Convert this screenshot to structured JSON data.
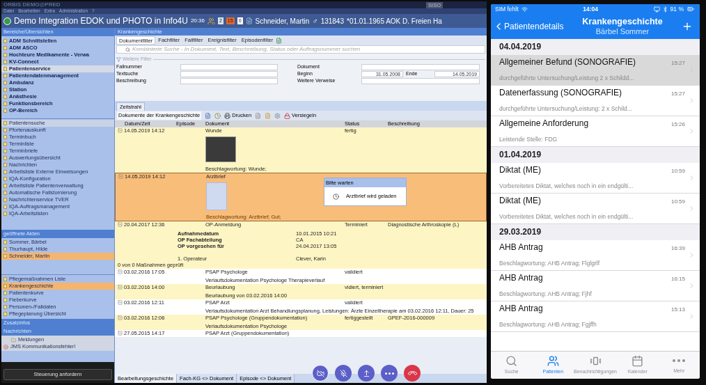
{
  "app": {
    "title": "ORBIS DEMO@PRED",
    "menu": [
      "Datei",
      "Bearbeiten",
      "Extra",
      "Administration",
      "?"
    ],
    "meeting_title": "Demo Integration EDOK und PHOTO in Info4U",
    "time": "20:36",
    "badges": [
      {
        "text": "2",
        "color": "#d6e2f3"
      },
      {
        "text": "15",
        "color": "#e0662e"
      },
      {
        "text": "0",
        "color": "#ffffff"
      }
    ],
    "patient": {
      "name": "Schneider, Martin",
      "gender": "♂",
      "id": "131843",
      "details": "*01.01.1965 AOK D. Freien Ha"
    },
    "top_right": "SISO"
  },
  "sidebar": {
    "header": "Bereiche/Übersichten",
    "areas": [
      {
        "label": "ADM Schnittstellen",
        "selected": false
      },
      {
        "label": "ADM ASCO",
        "selected": false
      },
      {
        "label": "Hochteure Medikamente - Verwa",
        "selected": false
      },
      {
        "label": "KV-Connect",
        "selected": false
      },
      {
        "label": "Patientenservice",
        "selected": true
      },
      {
        "label": "Patientendatenmanagement",
        "selected": false
      },
      {
        "label": "Ambulanz",
        "selected": false
      },
      {
        "label": "Station",
        "selected": false
      },
      {
        "label": "Anästhesie",
        "selected": false
      },
      {
        "label": "Funktionsbereich",
        "selected": false
      },
      {
        "label": "OP-Bereich",
        "selected": false
      }
    ],
    "tools": [
      {
        "label": "Patientensuche",
        "selected": true
      },
      {
        "label": "Pfortenauskunft",
        "selected": false
      },
      {
        "label": "Terminbuch",
        "selected": false
      },
      {
        "label": "Terminliste",
        "selected": false
      },
      {
        "label": "Terminbriefe",
        "selected": false
      },
      {
        "label": "Auswertungsübersicht",
        "selected": false
      },
      {
        "label": "Nachrichten",
        "selected": false
      },
      {
        "label": "Arbeitsliste Externe Einweisungen",
        "selected": false
      },
      {
        "label": "IQA-Konfiguration",
        "selected": false
      },
      {
        "label": "Arbeitsliste Patientenverwaltung",
        "selected": false
      },
      {
        "label": "Automatische Fallstornierung",
        "selected": false
      },
      {
        "label": "Nachrichtenservice TVER",
        "selected": false
      },
      {
        "label": "IQA-Auftragsmanagement",
        "selected": false
      },
      {
        "label": "IQA-Arbeitslisten",
        "selected": false
      }
    ],
    "open_header": "geöffnete Akten",
    "open_files": [
      {
        "label": "Sommer, Bärbel",
        "selected": false
      },
      {
        "label": "Thurhaupt, Hilde",
        "selected": false
      },
      {
        "label": "Schneider, Martin",
        "selected": true
      }
    ],
    "views": [
      {
        "label": "Pflegemaßnahmen Liste",
        "selected": false
      },
      {
        "label": "Krankengeschichte",
        "selected": true
      },
      {
        "label": "Patientenkurve",
        "selected": false
      },
      {
        "label": "Fieberkurve",
        "selected": false
      },
      {
        "label": "Personen-/Falldaten",
        "selected": false
      },
      {
        "label": "Pflegeplanung Übersicht",
        "selected": false
      }
    ],
    "extra_header": "Zusatzinfos",
    "messages_header": "Nachrichten",
    "messages": [
      {
        "label": "Meldungen",
        "kind": "folder"
      },
      {
        "label": "JMS Kommunikationsfehler!",
        "kind": "error"
      }
    ],
    "control_button": "Steuerung anfordern"
  },
  "main": {
    "header": "Krankengeschichte",
    "filter_tabs": [
      {
        "label": "Dokumentfilter",
        "selected": true
      },
      {
        "label": "Fachfilter",
        "selected": false
      },
      {
        "label": "Fallfilter",
        "selected": false
      },
      {
        "label": "Ereignisfilter",
        "selected": false
      },
      {
        "label": "Episodenfilter",
        "selected": false
      }
    ],
    "search": {
      "placeholder": "Kombinierte Suche - In Dokument, Text, Beschreibung, Status oder Auftragsnummer suchen"
    },
    "more_filters": {
      "label": "Weitere Filter",
      "left": [
        {
          "label": "Fallnummer"
        },
        {
          "label": "Textsuche"
        },
        {
          "label": "Beschreibung"
        }
      ],
      "right": [
        {
          "label": "Dokument",
          "kind": "text"
        },
        {
          "label": "Beginn",
          "kind": "range",
          "value": "31.05.2008",
          "end_label": "Ende",
          "end_value": "14.05.2019"
        },
        {
          "label": "Weitere Verweise",
          "kind": "text"
        }
      ]
    },
    "timeline_tab": "Zeitstrahl",
    "toolbar": {
      "label": "Dokumente der Krankengeschichte",
      "print": "Drucken",
      "seal": "Versiegeln"
    },
    "table": {
      "columns": [
        "Datum/Zeit",
        "Episode",
        "Dokument",
        "Status",
        "Beschreibung"
      ],
      "rows": [
        {
          "kind": "photo",
          "date": "14.05.2019 14:12",
          "document": "Wunde",
          "status": "fertig",
          "note": "Beschlagwortung: Wunde;",
          "selected": false,
          "highlighted": true
        },
        {
          "kind": "scan",
          "date": "14.05.2019 14:12",
          "document": "Arztbrief",
          "note": "Beschlagwortung: Arztbrief; Gut;",
          "selected": true
        },
        {
          "kind": "op",
          "date": "20.04.2017 12:36",
          "document": "OP-Anmeldung",
          "status": "Terminiert",
          "description": "Diagnostische Arthroskopie (L)",
          "details": [
            {
              "label": "Aufnahmedatum",
              "value": "10.01.2015 10:21"
            },
            {
              "label": "OP Fachabteilung",
              "value": "CA"
            },
            {
              "label": "OP vorgesehen für",
              "value": "24.04.2017 13:05"
            }
          ],
          "surgeon": {
            "label": "1. Operateur",
            "value": "Clever, Karin"
          },
          "summary": "0 von 0 Maßnahmen geprüft",
          "selected": false,
          "highlighted": true
        },
        {
          "kind": "text",
          "date": "03.02.2016 17:05",
          "document": "PSAP Psychologe",
          "status": "validiert",
          "note": "Verlaufsdokumentation Psychologe Therapieverlauf",
          "selected": false,
          "highlighted": false
        },
        {
          "kind": "text",
          "date": "03.02.2016 14:00",
          "document": "Beurlaubung",
          "status": "vidiert, terminiert",
          "note": "Beurlaubung von 03.02.2016 14:00",
          "selected": false,
          "highlighted": true
        },
        {
          "kind": "text",
          "date": "03.02.2016 12:11",
          "document": "PSAP Arzt",
          "status": "validiert",
          "note": "Verlaufsdokumentation Arzt Behandlungsplanung, Leistungen: Ärzte Einzeltherapie am 03.02.2016 12:11, Dauer: 25",
          "selected": false,
          "highlighted": false
        },
        {
          "kind": "text",
          "date": "03.02.2016 12:06",
          "document": "PSAP Psychologe (Gruppendokumentation)",
          "status": "fertiggestellt",
          "description": "GPEF-2016-000009",
          "note": "Verlaufsdokumentation Psychologe",
          "selected": false,
          "highlighted": true
        },
        {
          "kind": "text",
          "date": "27.05.2015 14:17",
          "document": "PSAP Arzt (Gruppendokumentation)",
          "selected": false,
          "highlighted": false
        }
      ]
    },
    "popup": {
      "title": "Bitte warten",
      "message": "Arztbrief wird geladen"
    },
    "bottom_tabs": [
      {
        "label": "Bearbeitungsgeschichte",
        "selected": true
      },
      {
        "label": "Fach-KG <> Dokument",
        "selected": false
      },
      {
        "label": "Episode <> Dokument",
        "selected": false
      }
    ]
  },
  "phone": {
    "carrier": "SIM fehlt",
    "time": "14:04",
    "battery": "91 %",
    "back": "Patientendetails",
    "title": "Krankengeschichte",
    "subtitle": "Bärbel Sommer",
    "sections": [
      {
        "date": "04.04.2019",
        "items": [
          {
            "title": "Allgemeiner Befund (SONOGRAFIE)",
            "subtitle": "durchgeführte Untersuchung/Leistung 2 x Schildd...",
            "time": "15:27",
            "selected": true
          },
          {
            "title": "Datenerfassung (SONOGRAFIE)",
            "subtitle": "durchgeführte Untersuchung/Leistung: 2 x Schild...",
            "time": "15:27",
            "selected": false
          },
          {
            "title": "Allgemeine Anforderung",
            "subtitle": "Leistende Stelle: FDG",
            "time": "15:26",
            "selected": false
          }
        ]
      },
      {
        "date": "01.04.2019",
        "items": [
          {
            "title": "Diktat (ME)",
            "subtitle": "Vorbereitetes Diktat, welches noch in ein endgülti...",
            "time": "10:59",
            "selected": false
          },
          {
            "title": "Diktat (ME)",
            "subtitle": "Vorbereitetes Diktat, welches noch in ein endgülti...",
            "time": "10:59",
            "selected": false
          }
        ]
      },
      {
        "date": "29.03.2019",
        "items": [
          {
            "title": "AHB Antrag",
            "subtitle": "Beschlagwortung: AHB Antrag; Flglgrlf",
            "time": "16:39",
            "selected": false
          },
          {
            "title": "AHB Antrag",
            "subtitle": "Beschlagwortung: AHB Antrag; Fjhf",
            "time": "16:15",
            "selected": false
          },
          {
            "title": "AHB Antrag",
            "subtitle": "Beschlagwortung: AHB Antrag; Fgjffh",
            "time": "15:13",
            "selected": false
          }
        ]
      }
    ],
    "tabs": [
      {
        "label": "Suche",
        "selected": false
      },
      {
        "label": "Patienten",
        "selected": true
      },
      {
        "label": "Benachrichtigungen",
        "selected": false
      },
      {
        "label": "Kalender",
        "selected": false
      },
      {
        "label": "Mehr",
        "selected": false
      }
    ]
  }
}
